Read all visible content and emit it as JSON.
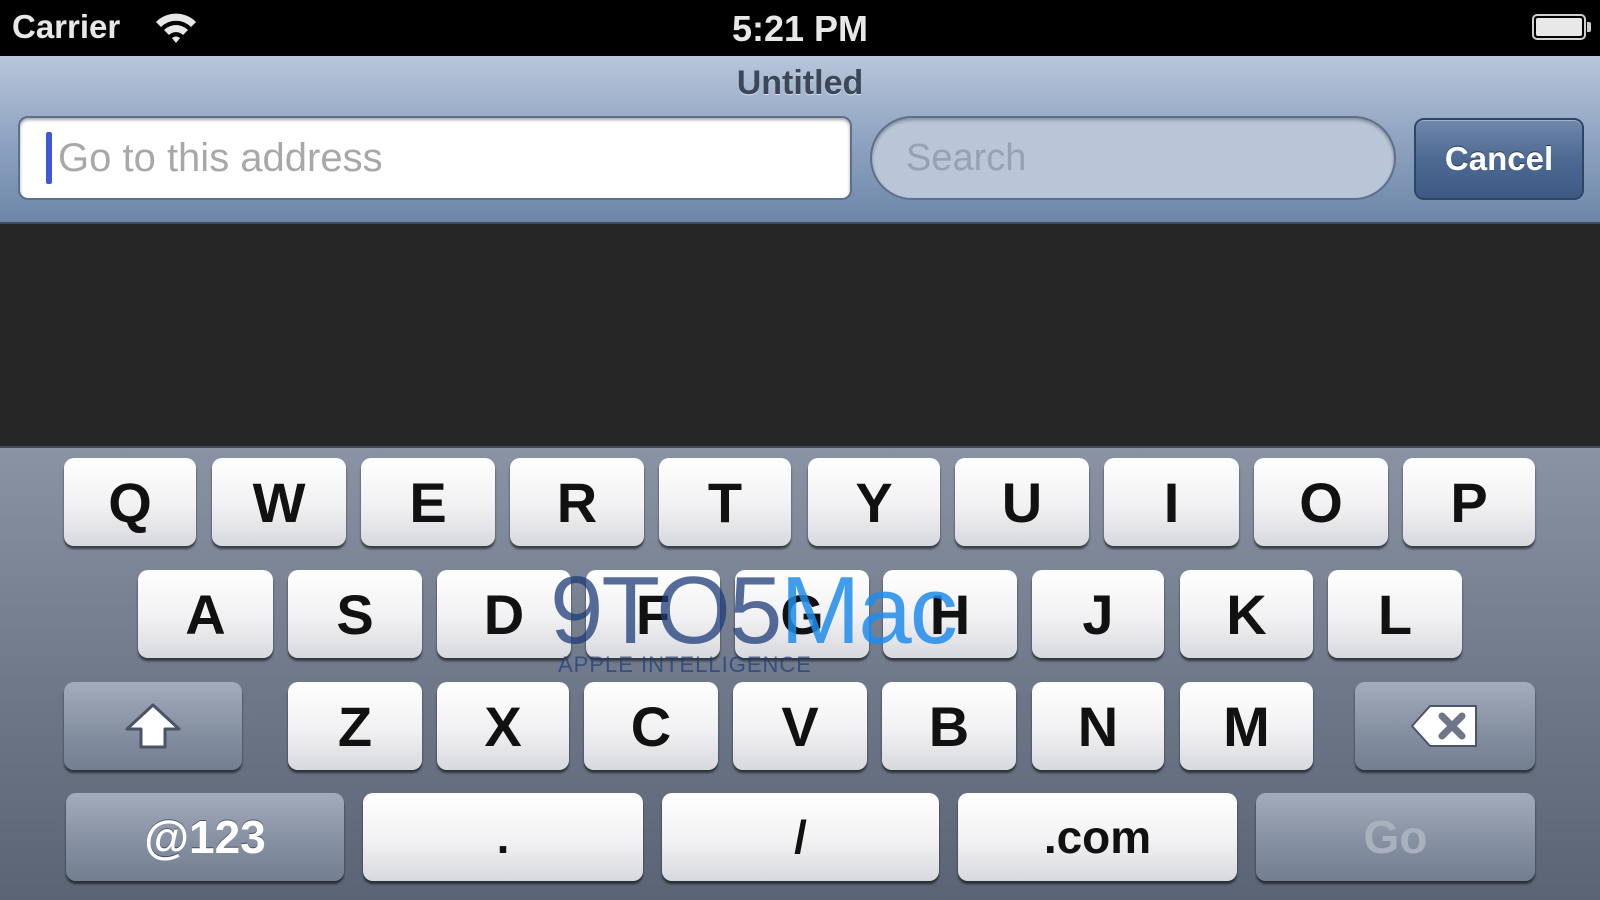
{
  "status_bar": {
    "carrier": "Carrier",
    "time": "5:21 PM",
    "wifi_icon": "wifi-icon",
    "battery_icon": "battery-icon"
  },
  "nav": {
    "title": "Untitled",
    "address_placeholder": "Go to this address",
    "search_placeholder": "Search",
    "cancel_label": "Cancel"
  },
  "keyboard": {
    "row1": [
      "Q",
      "W",
      "E",
      "R",
      "T",
      "Y",
      "U",
      "I",
      "O",
      "P"
    ],
    "row2": [
      "A",
      "S",
      "D",
      "F",
      "G",
      "H",
      "J",
      "K",
      "L"
    ],
    "row3": [
      "Z",
      "X",
      "C",
      "V",
      "B",
      "N",
      "M"
    ],
    "row4": {
      "numbers": "@123",
      "dot": ".",
      "slash": "/",
      "dotcom": ".com",
      "go": "Go"
    },
    "shift_icon": "shift-arrow-icon",
    "delete_icon": "backspace-icon"
  },
  "watermark": {
    "logo_prefix": "9TO5",
    "logo_suffix": "Mac",
    "tagline": "APPLE INTELLIGENCE"
  },
  "colors": {
    "nav_bar": "#8fa4c1",
    "cursor": "#3d5bd6",
    "watermark_mac": "#1e8ceb"
  }
}
